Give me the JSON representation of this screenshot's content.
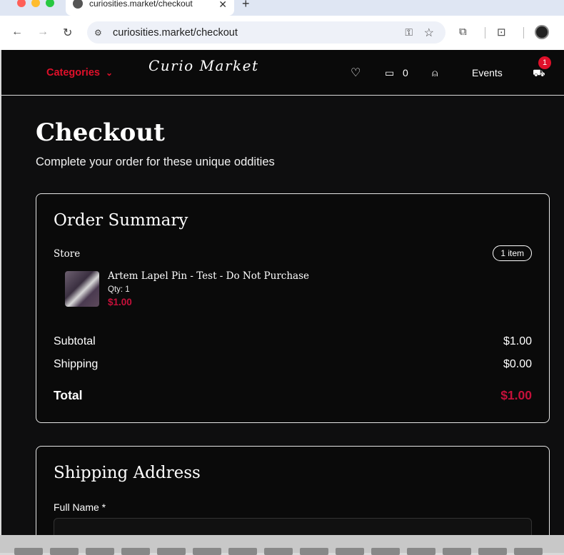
{
  "browser": {
    "tab_title": "curiosities.market/checkout",
    "url": "curiosities.market/checkout"
  },
  "header": {
    "categories_label": "Categories",
    "logo_text": "Curio Market",
    "messages_count": "0",
    "events_label": "Events",
    "cart_count": "1"
  },
  "page": {
    "title": "Checkout",
    "subtitle": "Complete your order for these unique oddities"
  },
  "order_summary": {
    "title": "Order Summary",
    "store_label": "Store",
    "item_count_badge": "1 item",
    "item": {
      "name": "Artem Lapel Pin - Test - Do Not Purchase",
      "qty": "Qty: 1",
      "price": "$1.00"
    },
    "subtotal_label": "Subtotal",
    "subtotal_value": "$1.00",
    "shipping_label": "Shipping",
    "shipping_value": "$0.00",
    "total_label": "Total",
    "total_value": "$1.00"
  },
  "shipping_address": {
    "title": "Shipping Address",
    "full_name_label": "Full Name *",
    "full_name_value": ""
  },
  "colors": {
    "accent_red": "#e0102a",
    "price_red": "#c5103a",
    "page_bg": "#0e0e0f"
  }
}
